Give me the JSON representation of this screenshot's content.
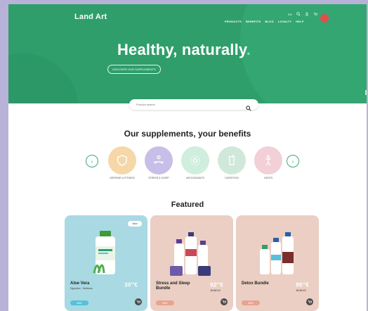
{
  "brand": {
    "logo": "Land Art"
  },
  "top_util": {
    "language": "EN"
  },
  "nav": {
    "items": [
      "PRODUCTS",
      "BENEFITS",
      "BLOG",
      "LOYALTY",
      "HELP"
    ]
  },
  "hero": {
    "title": "Healthy, naturally",
    "title_dot": ".",
    "button": "DISCOVER OUR SUPPLEMENTS",
    "color": "#2f9e6b"
  },
  "search": {
    "placeholder": "Product search"
  },
  "supplements": {
    "title": "Our supplements, your benefits",
    "categories": [
      {
        "label": "DEFENSE & FITNESS",
        "color": "#f6d7a8",
        "icon": "shield-icon"
      },
      {
        "label": "STRESS & SLEEP",
        "color": "#c7bfe8",
        "icon": "meditation-icon"
      },
      {
        "label": "ANTIOXIDANTS",
        "color": "#cfeedd",
        "icon": "antioxidant-icon"
      },
      {
        "label": "DIGESTION",
        "color": "#cfe8da",
        "icon": "drink-icon"
      },
      {
        "label": "JOINTS",
        "color": "#f3cfd8",
        "icon": "joints-icon"
      }
    ]
  },
  "featured": {
    "title": "Featured",
    "cards": [
      {
        "name": "Aloe Vera",
        "sub": "Digestion · Wellness",
        "price": "30",
        "price_cents": "90",
        "currency": "€",
        "badge": "New",
        "cta": "ADD",
        "bg": "#a9d9e3",
        "cta_color": "#58c0d8"
      },
      {
        "name": "Stress and Sleep Bundle",
        "price": "92",
        "price_cents": "10",
        "currency": "€",
        "price_sub": "BUNDLE",
        "cta": "ADD",
        "bg": "#ebcfc4",
        "cta_color": "#e9a38e"
      },
      {
        "name": "Detox Bundle",
        "price": "90",
        "price_cents": "15",
        "currency": "€",
        "price_sub": "BUNDLE",
        "cta": "ADD",
        "bg": "#ebcfc4",
        "cta_color": "#e9a38e"
      }
    ]
  }
}
